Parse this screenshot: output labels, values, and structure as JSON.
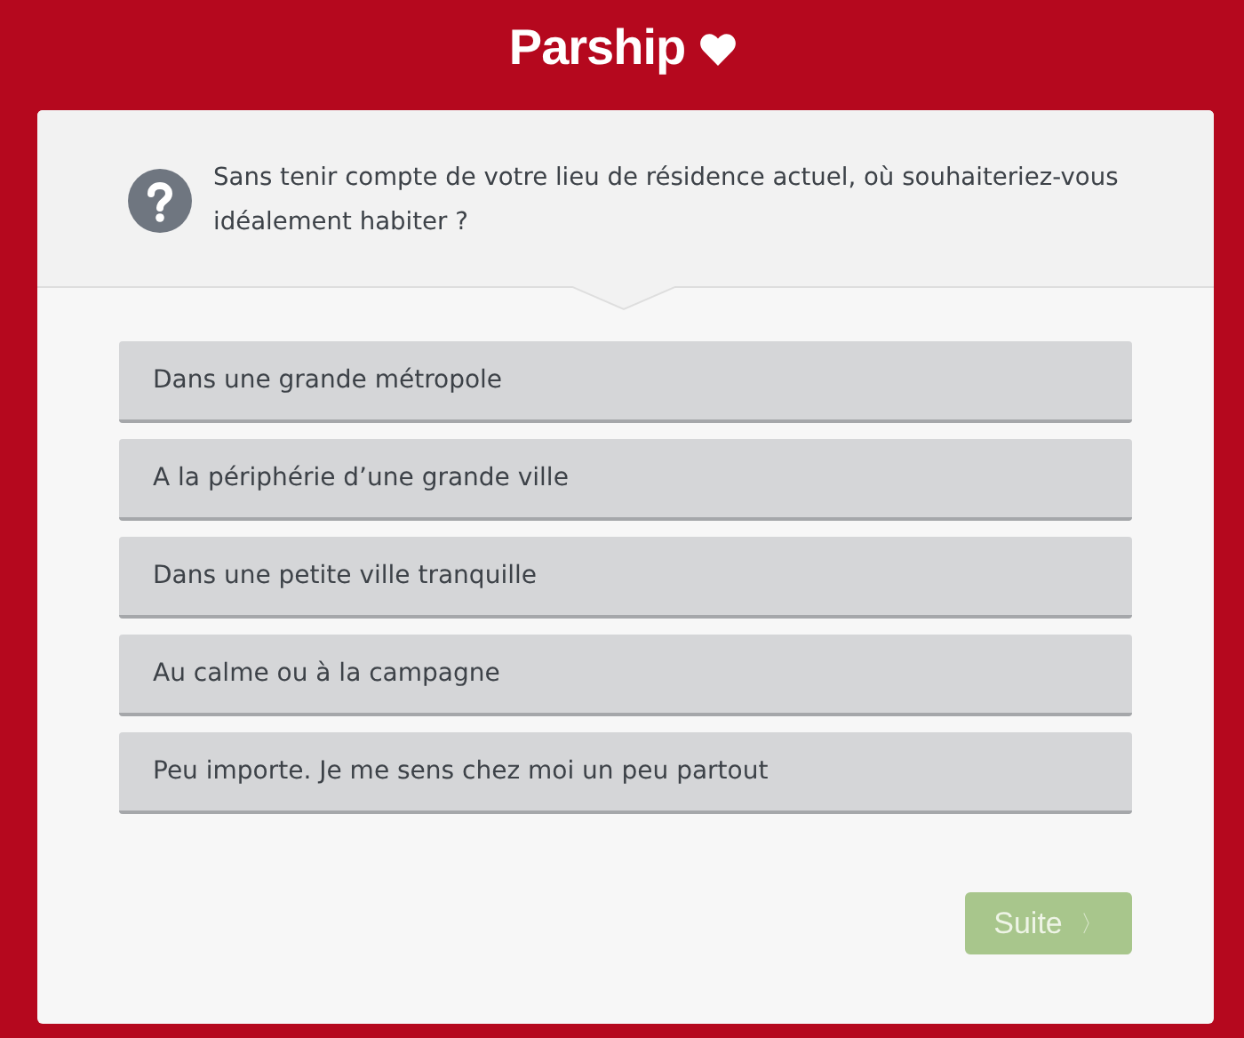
{
  "logo": {
    "text": "Parship"
  },
  "question": {
    "text": "Sans tenir compte de votre lieu de résidence actuel, où souhaiteriez-vous idéalement habiter ?"
  },
  "options": [
    {
      "label": "Dans une grande métropole",
      "selected": false
    },
    {
      "label": "A la périphérie d’une grande ville",
      "selected": false
    },
    {
      "label": "Dans une petite ville tranquille",
      "selected": false
    },
    {
      "label": "Au calme ou à la campagne",
      "selected": false
    },
    {
      "label": "Peu importe. Je me sens chez moi un peu partout",
      "selected": false
    }
  ],
  "next_button": {
    "label": "Suite",
    "chevron": "〉",
    "disabled": true
  }
}
